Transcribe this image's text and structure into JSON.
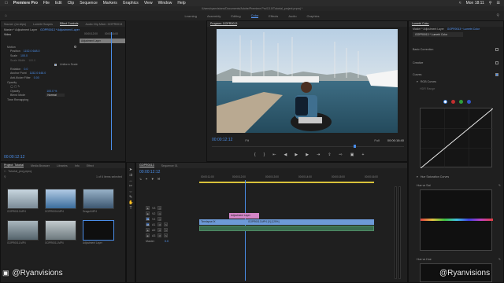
{
  "menubar": {
    "app": "Premiere Pro",
    "items": [
      "File",
      "Edit",
      "Clip",
      "Sequence",
      "Markers",
      "Graphics",
      "View",
      "Window",
      "Help"
    ],
    "clock": "Mon 18:11"
  },
  "path": "/Users/ryanvisions/Documents/Adobe/Premiere Pro/13.0/Tutorial_project.prproj *",
  "workspaces": [
    "Learning",
    "Assembly",
    "Editing",
    "Color",
    "Effects",
    "Audio",
    "Graphics"
  ],
  "workspace_active": "Color",
  "source_tabs": [
    "Source: (no clips)",
    "Lumetri Scopes",
    "Effect Controls",
    "Audio Clip Mixer: GOPR0013"
  ],
  "ec": {
    "master": "Master * Adjustment Layer",
    "seq": "GOPR0013 * Adjustment Layer",
    "ruler": "00:00:12:00",
    "ruler2": "00:00:16:00",
    "clip": "Adjustment Layer",
    "section": "Video",
    "rows": [
      {
        "name": "Motion",
        "val": ""
      },
      {
        "name": "Position",
        "val": "1152.0   648.0"
      },
      {
        "name": "Scale",
        "val": "100.0"
      },
      {
        "name": "Scale Width",
        "val": "100.0"
      },
      {
        "name": "",
        "val": "Uniform Scale"
      },
      {
        "name": "Rotation",
        "val": "0.0"
      },
      {
        "name": "Anchor Point",
        "val": "1152.0   648.0"
      },
      {
        "name": "Anti-flicker Filter",
        "val": "0.00"
      },
      {
        "name": "Opacity",
        "val": ""
      },
      {
        "name": "",
        "val": ""
      },
      {
        "name": "Opacity",
        "val": "100.0 %"
      },
      {
        "name": "Blend Mode",
        "val": "Normal"
      },
      {
        "name": "Time Remapping",
        "val": ""
      }
    ],
    "timecode": "00:00:12:12"
  },
  "program": {
    "title": "Program: GOPR0013",
    "timecode": "00:00:12:12",
    "fit": "Fit",
    "quality": "Full",
    "duration": "00:00:16:40"
  },
  "project": {
    "tabs": [
      "Project: Tutorial",
      "Media Browser",
      "Libraries",
      "Info",
      "Effect"
    ],
    "name": "Tutorial_proj.prproj",
    "count": "1 of 6 items selected",
    "items": [
      {
        "label": "GOPR0013.MP4",
        "dur": "15:40",
        "color": "#8d9aa6"
      },
      {
        "label": "GOPR0004.MP4",
        "dur": "2:13",
        "color": "#5a7fa8"
      },
      {
        "label": "Seagull.MP4",
        "dur": "5:00",
        "color": "#5d7690"
      },
      {
        "label": "GOPR0011.MP4",
        "dur": "3:20",
        "color": "#6f7d86"
      },
      {
        "label": "GOPR0011.MP4",
        "dur": "5:12",
        "color": "#7e8a8f"
      },
      {
        "label": "Adjustment Layer",
        "dur": "4:29",
        "color": "#0f0f0f"
      }
    ]
  },
  "timeline": {
    "tabs": [
      "GOPR0013",
      "Sequence 01"
    ],
    "timecode": "00:00:12:12",
    "ruler": [
      "00:00:11:00",
      "00:00:12:00",
      "00:00:13:00",
      "00:00:14:00",
      "00:00:15:00",
      "00:00:16:00"
    ],
    "tracks": [
      "V3",
      "V2",
      "V1",
      "A1",
      "A2",
      "A3"
    ],
    "master": "Master",
    "master_val": "0.0",
    "clips": {
      "adj": "Adjustment Layer",
      "v1a": "Timelapse.fX",
      "v1b": "GOPR0013.MP4 [V] [125%]"
    }
  },
  "lumetri": {
    "title": "Lumetri Color",
    "master": "Master * Adjustment Layer",
    "seq": "GOPR0013 * Lumetri Color",
    "sections": [
      "Basic Correction",
      "Creative",
      "Curves"
    ],
    "rgb": "RGB Curves",
    "hdr": "HDR Range",
    "hue_sat": "Hue Saturation Curves",
    "hvs": "Hue vs Sat",
    "hvh": "Hue vs Hue"
  },
  "watermark": {
    "left": "@Ryanvisions",
    "right": "@Ryanvisions"
  },
  "colors": {
    "accent": "#4a8de8",
    "adj_clip": "#d486c8",
    "video_clip": "#6d9ad8"
  }
}
